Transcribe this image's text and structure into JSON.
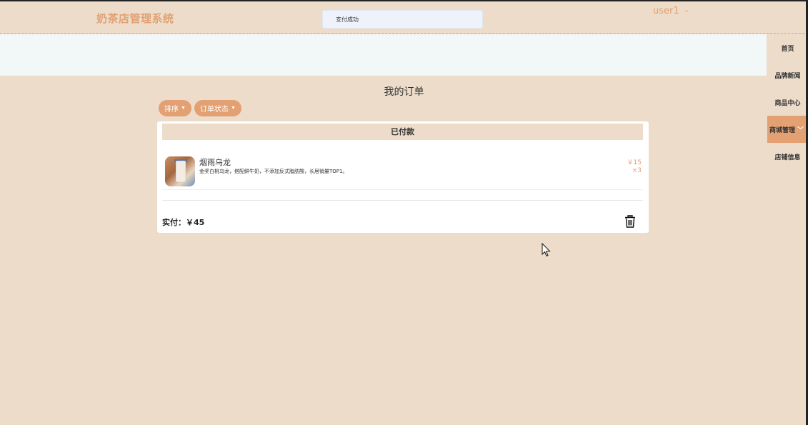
{
  "header": {
    "brand": "奶茶店管理系统",
    "user": "user1",
    "user_menu_mark": "-"
  },
  "toast": {
    "message": "支付成功"
  },
  "nav": {
    "items": [
      {
        "label": "首页"
      },
      {
        "label": "品牌新闻"
      },
      {
        "label": "商品中心"
      },
      {
        "label": "商城管理",
        "active": true
      },
      {
        "label": "店铺信息"
      }
    ]
  },
  "main": {
    "title": "我的订单",
    "filters": {
      "sort_label": "排序",
      "status_label": "订单状态"
    }
  },
  "order": {
    "status": "已付款",
    "items": [
      {
        "name": "烟雨乌龙",
        "description": "金奖白桃乌龙，搭配鲜牛奶，不添加反式脂肪酸，长居销量TOP1。",
        "price": "￥15",
        "quantity": "×3"
      }
    ],
    "paid_text": "实付：￥45"
  },
  "icons": {
    "trash": "trash-icon",
    "cursor": "mouse-pointer-icon",
    "chevron": "chevron-down-icon"
  },
  "colors": {
    "accent": "#e3a072",
    "background": "#ecdcc9",
    "banner": "#f2f7f8"
  }
}
